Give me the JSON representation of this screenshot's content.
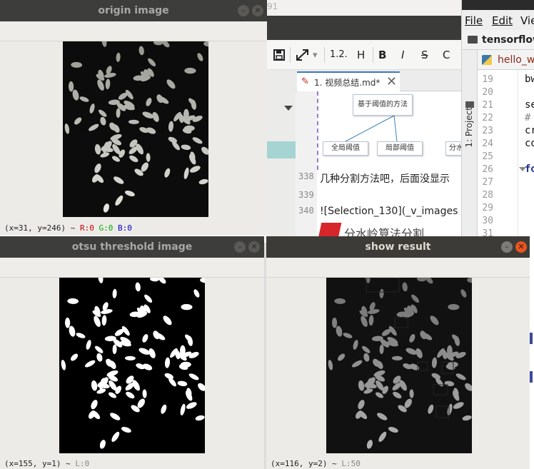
{
  "editor": {
    "top_text": "91",
    "toolbar": {
      "heading_level": "1.2.",
      "h": "H",
      "bold": "B",
      "italic": "I",
      "strike": "S",
      "code": "C"
    },
    "tab": {
      "label": "1. 视频总结.md*",
      "close": "✕"
    },
    "diagram": {
      "root": "基于阈值的方法",
      "left": "全局阈值",
      "right": "局部阈值",
      "partial": "分水"
    },
    "lines": [
      {
        "num": "338",
        "text": "几种分割方法吧，后面没显示"
      },
      {
        "num": "339",
        "text": ""
      },
      {
        "num": "340",
        "text": "![Selection_130](_v_images"
      }
    ],
    "logo_text": "分水岭算法分割"
  },
  "ide": {
    "menu": {
      "file": "File",
      "edit": "Edit",
      "view": "Vie"
    },
    "project_name": "tensorflow",
    "side_tab": "1: Project",
    "file_tab": "hello_w",
    "line_numbers": [
      "19",
      "20",
      "21",
      "22",
      "23",
      "24",
      "25",
      "26",
      "27",
      "28",
      "29",
      "30",
      "31"
    ],
    "code": {
      "l19": "bw",
      "l21": "se",
      "l22": "#",
      "l23": "cr",
      "l24": "co",
      "l26": "fo"
    }
  },
  "windows": {
    "origin": {
      "title": "origin image",
      "status_coords": "(x=31, y=246) ~",
      "status_r": "R:0",
      "status_g": "G:0",
      "status_b": "B:0"
    },
    "otsu": {
      "title": "otsu threshold image",
      "status_coords": "(x=155, y=1) ~",
      "status_l": "L:0"
    },
    "result": {
      "title": "show result",
      "status_coords": "(x=116, y=2) ~",
      "status_l": "L:50"
    }
  },
  "icons": {
    "minimize": "minimize-icon",
    "close": "close-icon"
  },
  "colors": {
    "close_active": "#e9541f",
    "title_bar": "#3c3b37",
    "status_r": "#cc0000",
    "status_g": "#00aa00",
    "status_b": "#0000cc"
  }
}
